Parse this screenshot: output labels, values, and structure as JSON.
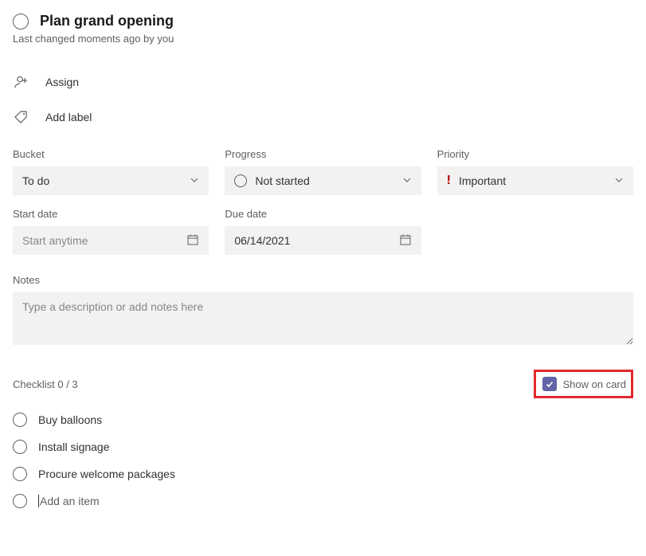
{
  "header": {
    "title": "Plan grand opening",
    "last_changed": "Last changed moments ago by you"
  },
  "actions": {
    "assign_label": "Assign",
    "add_label_label": "Add label"
  },
  "fields": {
    "bucket": {
      "label": "Bucket",
      "value": "To do"
    },
    "progress": {
      "label": "Progress",
      "value": "Not started"
    },
    "priority": {
      "label": "Priority",
      "value": "Important"
    },
    "start_date": {
      "label": "Start date",
      "placeholder": "Start anytime",
      "value": ""
    },
    "due_date": {
      "label": "Due date",
      "value": "06/14/2021"
    }
  },
  "notes": {
    "label": "Notes",
    "placeholder": "Type a description or add notes here",
    "value": ""
  },
  "checklist": {
    "title": "Checklist 0 / 3",
    "show_on_card_label": "Show on card",
    "show_on_card_checked": true,
    "items": [
      {
        "text": "Buy balloons"
      },
      {
        "text": "Install signage"
      },
      {
        "text": "Procure welcome packages"
      }
    ],
    "add_item_placeholder": "Add an item"
  }
}
